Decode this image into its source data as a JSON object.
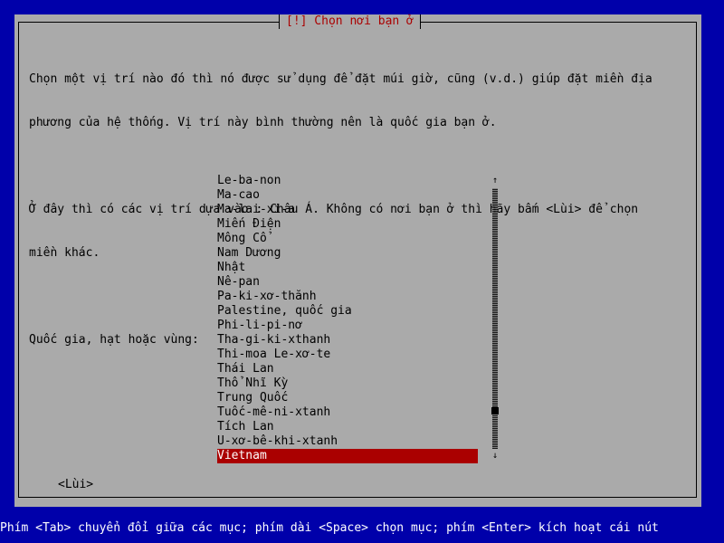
{
  "dialog": {
    "title": "[!] Chọn nơi bạn ở",
    "paragraph1_line1": "Chọn một vị trí nào đó thì nó được sử dụng để đặt múi giờ, cũng (v.d.) giúp đặt miền địa",
    "paragraph1_line2": "phương của hệ thống. Vị trí này bình thường nên là quốc gia bạn ở.",
    "paragraph2_line1": "Ở đây thì có các vị trí dựa vào : Châu Á. Không có nơi bạn ở thì hãy bấm <Lùi> để chọn",
    "paragraph2_line2": "miền khác.",
    "list_label": "Quốc gia, hạt hoặc vùng:",
    "items": [
      "Le-ba-non",
      "Ma-cao",
      "Ma-lai-xi-a",
      "Miến Điện",
      "Mông Cổ",
      "Nam Dương",
      "Nhật",
      "Nê-pan",
      "Pa-ki-xơ-thănh",
      "Palestine, quốc gia",
      "Phi-li-pi-nơ",
      "Tha-gi-ki-xthanh",
      "Thi-moa Le-xơ-te",
      "Thái Lan",
      "Thổ Nhĩ Kỳ",
      "Trung Quốc",
      "Tuốc-mê-ni-xtanh",
      "Tích Lan",
      "U-xơ-bê-khi-xtanh",
      "Vietnam"
    ],
    "selected_item": "Vietnam",
    "back_button": "<Lùi>",
    "scroll_up_icon": "arrow-up",
    "scroll_down_icon": "arrow-down"
  },
  "status_bar": "Phím <Tab> chuyển đổi giữa các mục; phím dài <Space> chọn mục; phím <Enter> kích hoạt cái nút",
  "colors": {
    "background": "#0000aa",
    "dialog": "#aaaaaa",
    "title": "#aa0000",
    "selection": "#aa0000",
    "status_text": "#ffffff"
  }
}
